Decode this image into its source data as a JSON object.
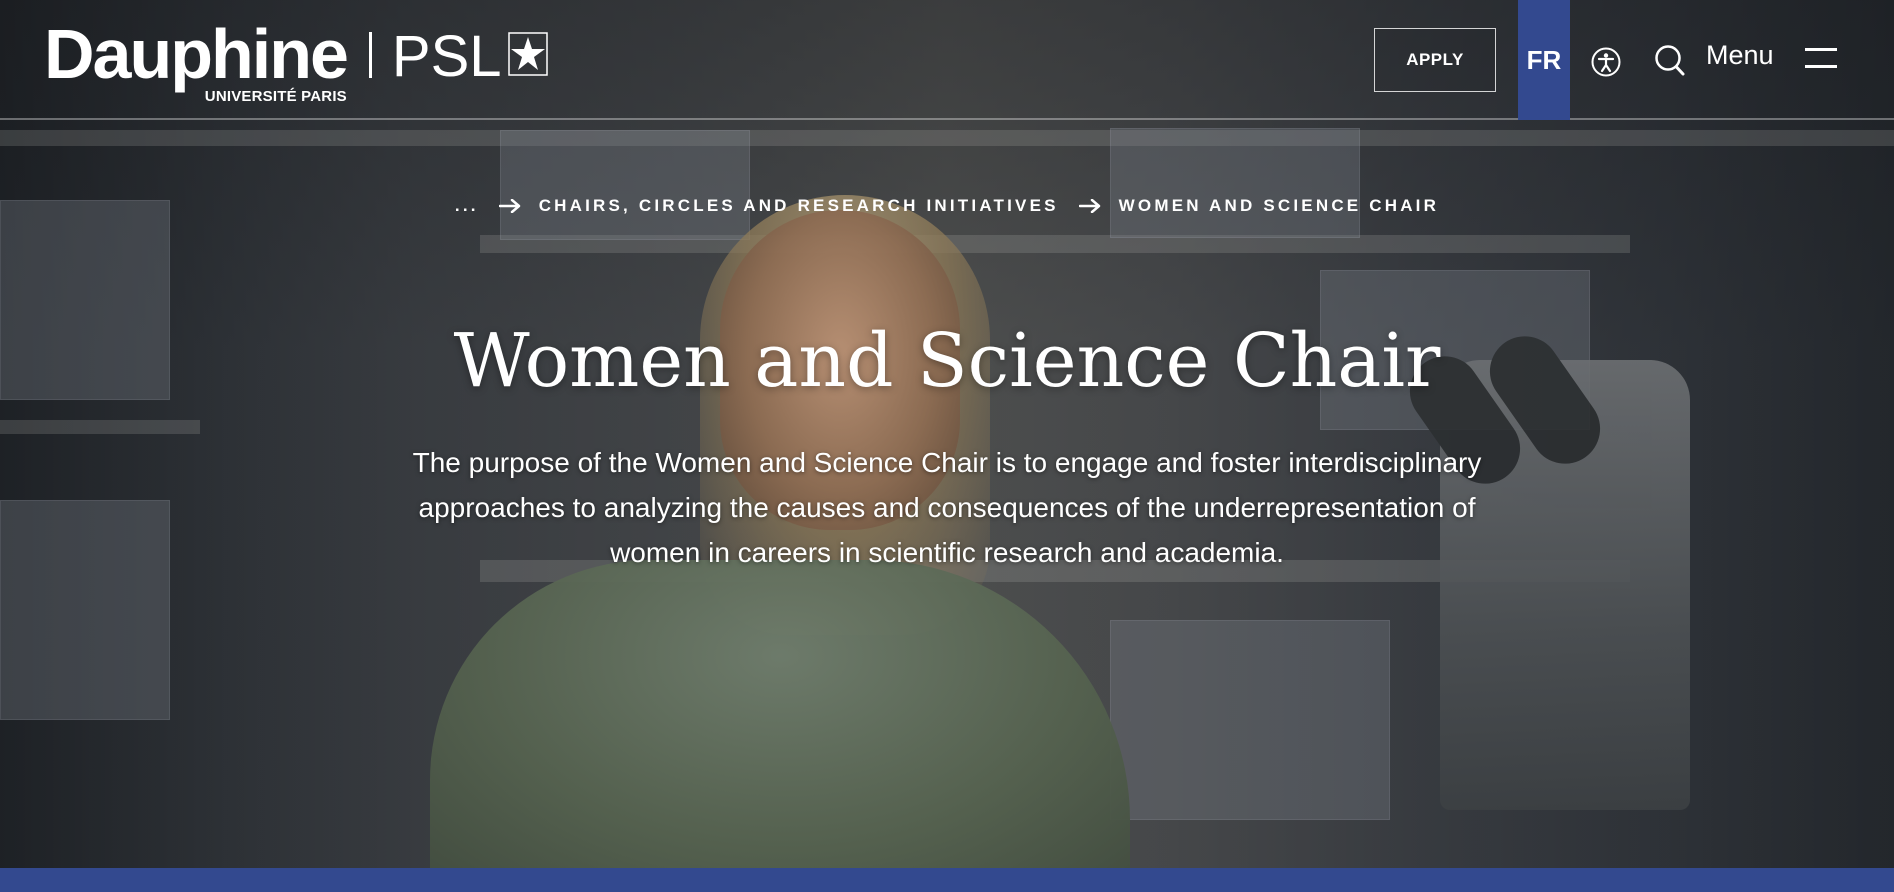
{
  "header": {
    "logo": {
      "wordmark": "Dauphine",
      "subtitle": "UNIVERSITÉ PARIS",
      "partner": "PSL"
    },
    "apply_label": "APPLY",
    "language_label": "FR",
    "menu_label": "Menu"
  },
  "breadcrumb": {
    "items": [
      {
        "label": "..."
      },
      {
        "label": "CHAIRS, CIRCLES AND RESEARCH INITIATIVES"
      },
      {
        "label": "WOMEN AND SCIENCE CHAIR"
      }
    ]
  },
  "hero": {
    "title": "Women and Science Chair",
    "intro": "The purpose of the Women and Science Chair is to engage and foster interdisciplinary approaches to analyzing the causes and consequences of the underrepresentation of women in careers in scientific research and academia."
  },
  "icons": {
    "accessibility": "accessibility-icon",
    "search": "search-icon",
    "menu": "hamburger-menu-icon",
    "arrow": "arrow-right-icon",
    "psl_star": "psl-star-icon"
  },
  "colors": {
    "brand_blue": "#33498f",
    "text": "#ffffff"
  }
}
